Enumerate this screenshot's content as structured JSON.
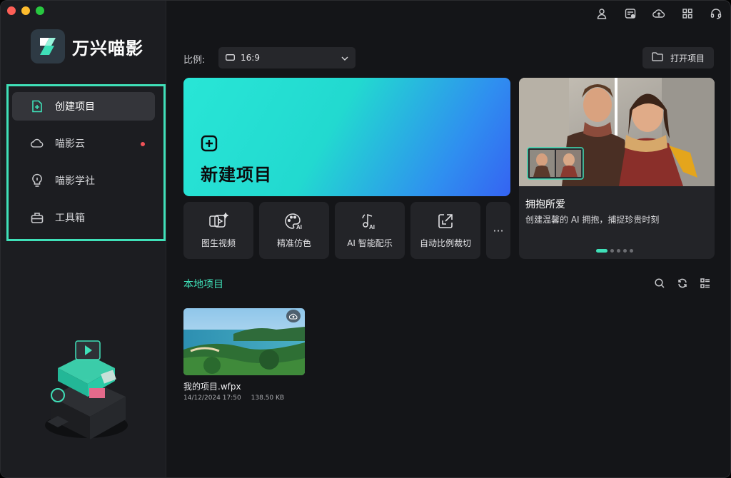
{
  "app": {
    "name": "万兴喵影"
  },
  "colors": {
    "accent": "#3fe0b8",
    "notification": "#f05258",
    "card_gradient_start": "#28e6d6",
    "card_gradient_end": "#3563f2"
  },
  "sidebar": {
    "items": [
      {
        "label": "创建项目",
        "icon": "new-project-icon",
        "active": true
      },
      {
        "label": "喵影云",
        "icon": "cloud-icon",
        "badge": true
      },
      {
        "label": "喵影学社",
        "icon": "lightbulb-icon"
      },
      {
        "label": "工具箱",
        "icon": "toolbox-icon"
      }
    ]
  },
  "topbar": {
    "icons": [
      "user-icon",
      "calendar-icon",
      "cloud-upload-icon",
      "apps-grid-icon",
      "headset-icon"
    ]
  },
  "ratio": {
    "label": "比例:",
    "value": "16:9"
  },
  "open_project": {
    "label": "打开项目"
  },
  "new_project": {
    "label": "新建项目"
  },
  "tools": [
    {
      "label": "图生视频",
      "icon": "image-to-video-icon"
    },
    {
      "label": "精准仿色",
      "icon": "palette-ai-icon"
    },
    {
      "label": "AI 智能配乐",
      "icon": "music-ai-icon"
    },
    {
      "label": "自动比例裁切",
      "icon": "auto-crop-icon"
    }
  ],
  "tools_more": "···",
  "promo": {
    "title": "拥抱所爱",
    "description": "创建温馨的 AI 拥抱，捕捉珍贵时刻",
    "slides": 5,
    "active_slide": 1
  },
  "local": {
    "title": "本地项目",
    "icons": [
      "search-icon",
      "refresh-icon",
      "list-view-icon"
    ],
    "projects": [
      {
        "name": "我的项目.wfpx",
        "date": "14/12/2024 17:50",
        "size": "138.50 KB"
      }
    ]
  }
}
